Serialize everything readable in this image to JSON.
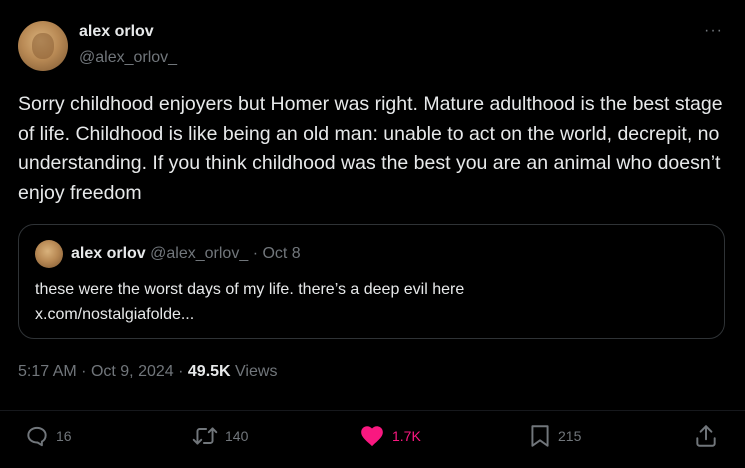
{
  "author": {
    "name": "alex orlov",
    "handle": "@alex_orlov_"
  },
  "tweet": {
    "text": "Sorry childhood enjoyers but Homer was right. Mature adulthood is the best stage of life. Childhood is like being an old man: unable to act on the world, decrepit, no understanding. If you think childhood was the best you are an animal who doesn’t enjoy freedom"
  },
  "quoted": {
    "name": "alex orlov",
    "handle": "@alex_orlov_",
    "separator": "·",
    "date": "Oct 8",
    "text_line1": "these were the worst days of my life. there’s a deep evil here",
    "text_line2": "x.com/nostalgiafolde..."
  },
  "meta": {
    "time": "5:17 AM",
    "sep1": "·",
    "date": "Oct 9, 2024",
    "sep2": "·",
    "views_count": "49.5K",
    "views_label": "Views"
  },
  "actions": {
    "replies": "16",
    "reposts": "140",
    "likes": "1.7K",
    "bookmarks": "215"
  },
  "more_label": "···",
  "colors": {
    "background": "#000000",
    "text": "#e7e9ea",
    "muted": "#71767b",
    "like": "#f91880",
    "border": "#2f3336"
  }
}
